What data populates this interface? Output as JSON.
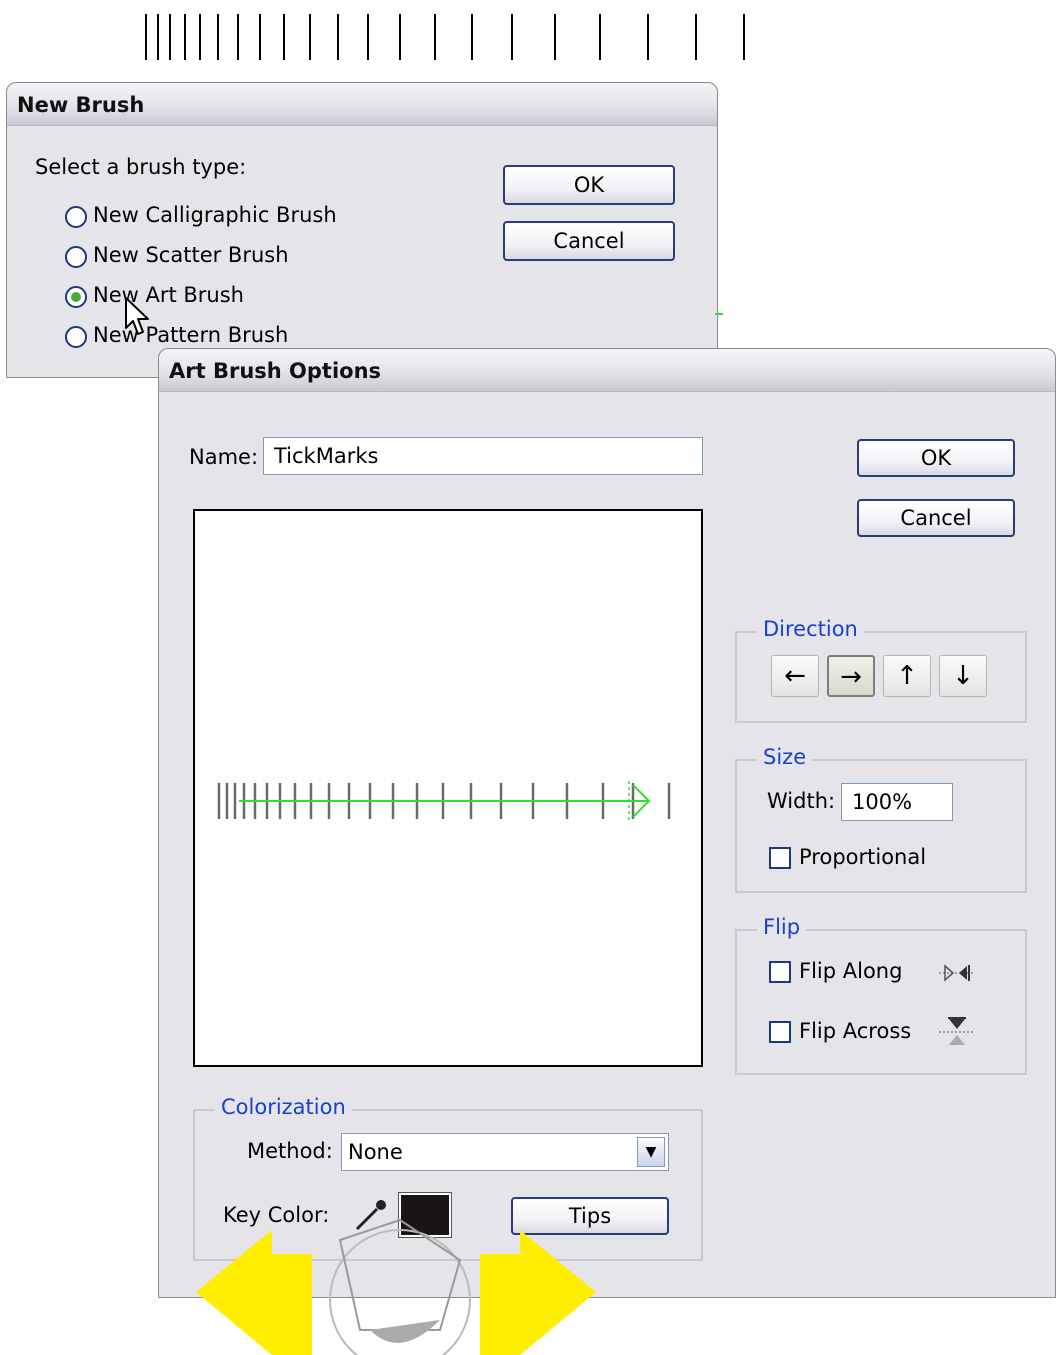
{
  "new_brush": {
    "title": "New Brush",
    "prompt": "Select a brush type:",
    "options": [
      "New Calligraphic Brush",
      "New Scatter Brush",
      "New Art Brush",
      "New Pattern Brush"
    ],
    "selected": "New Art Brush",
    "ok_label": "OK",
    "cancel_label": "Cancel"
  },
  "art_brush": {
    "title": "Art Brush Options",
    "name_label": "Name:",
    "name_value": "TickMarks",
    "ok_label": "OK",
    "cancel_label": "Cancel",
    "direction": {
      "title": "Direction",
      "buttons": [
        "←",
        "→",
        "↑",
        "↓"
      ],
      "selected": "→"
    },
    "size": {
      "title": "Size",
      "width_label": "Width:",
      "width_value": "100%",
      "proportional_label": "Proportional",
      "proportional_checked": false
    },
    "flip": {
      "title": "Flip",
      "along_label": "Flip Along",
      "across_label": "Flip Across",
      "along_checked": false,
      "across_checked": false
    },
    "colorization": {
      "title": "Colorization",
      "method_label": "Method:",
      "method_value": "None",
      "key_color_label": "Key Color:",
      "key_color": "#1a1414",
      "tips_label": "Tips"
    }
  },
  "colors": {
    "accent_green": "#2fe02f",
    "arrow_yellow": "#ffee00",
    "group_title_blue": "#1a3fd0"
  }
}
